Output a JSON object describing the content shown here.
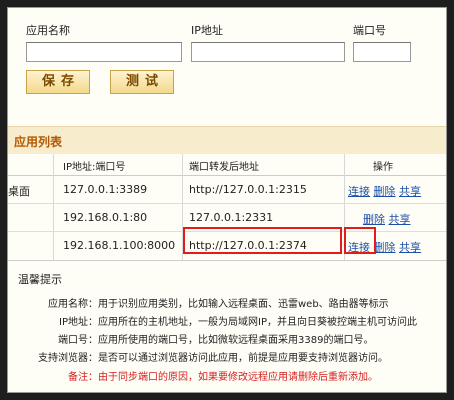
{
  "form": {
    "app_name_label": "应用名称",
    "ip_label": "IP地址",
    "port_label": "端口号",
    "app_name_value": "",
    "ip_value": "",
    "port_value": "",
    "save_label": "保存",
    "test_label": "测试"
  },
  "app_list": {
    "title": "应用列表",
    "headers": {
      "ip_port": "IP地址:端口号",
      "forward_addr": "端口转发后地址",
      "action": "操作"
    },
    "rows": [
      {
        "name_clip": "桌面",
        "ip_port": "127.0.0.1:3389",
        "forward": "http://127.0.0.1:2315",
        "connect": "连接",
        "delete": "删除",
        "share": "共享"
      },
      {
        "name_clip": "",
        "ip_port": "192.168.0.1:80",
        "forward": "127.0.0.1:2331",
        "connect": "",
        "delete": "删除",
        "share": "共享"
      },
      {
        "name_clip": "",
        "ip_port": "192.168.1.100:8000",
        "forward": "http://127.0.0.1:2374",
        "connect": "连接",
        "delete": "删除",
        "share": "共享"
      }
    ]
  },
  "tips": {
    "title": "温馨提示",
    "items": [
      {
        "label": "应用名称：",
        "text": "用于识别应用类别，比如输入远程桌面、迅雷web、路由器等标示"
      },
      {
        "label": "IP地址：",
        "text": "应用所在的主机地址，一般为局域网IP，并且向日葵被控端主机可访问此"
      },
      {
        "label": "端口号：",
        "text": "应用所使用的端口号，比如微软远程桌面采用3389的端口号。"
      },
      {
        "label": "支持浏览器：",
        "text": "是否可以通过浏览器访问此应用，前提是应用要支持浏览器访问。"
      },
      {
        "label": "备注：",
        "text": "由于同步端口的原因，如果要修改远程应用请删除后重新添加。"
      }
    ]
  }
}
